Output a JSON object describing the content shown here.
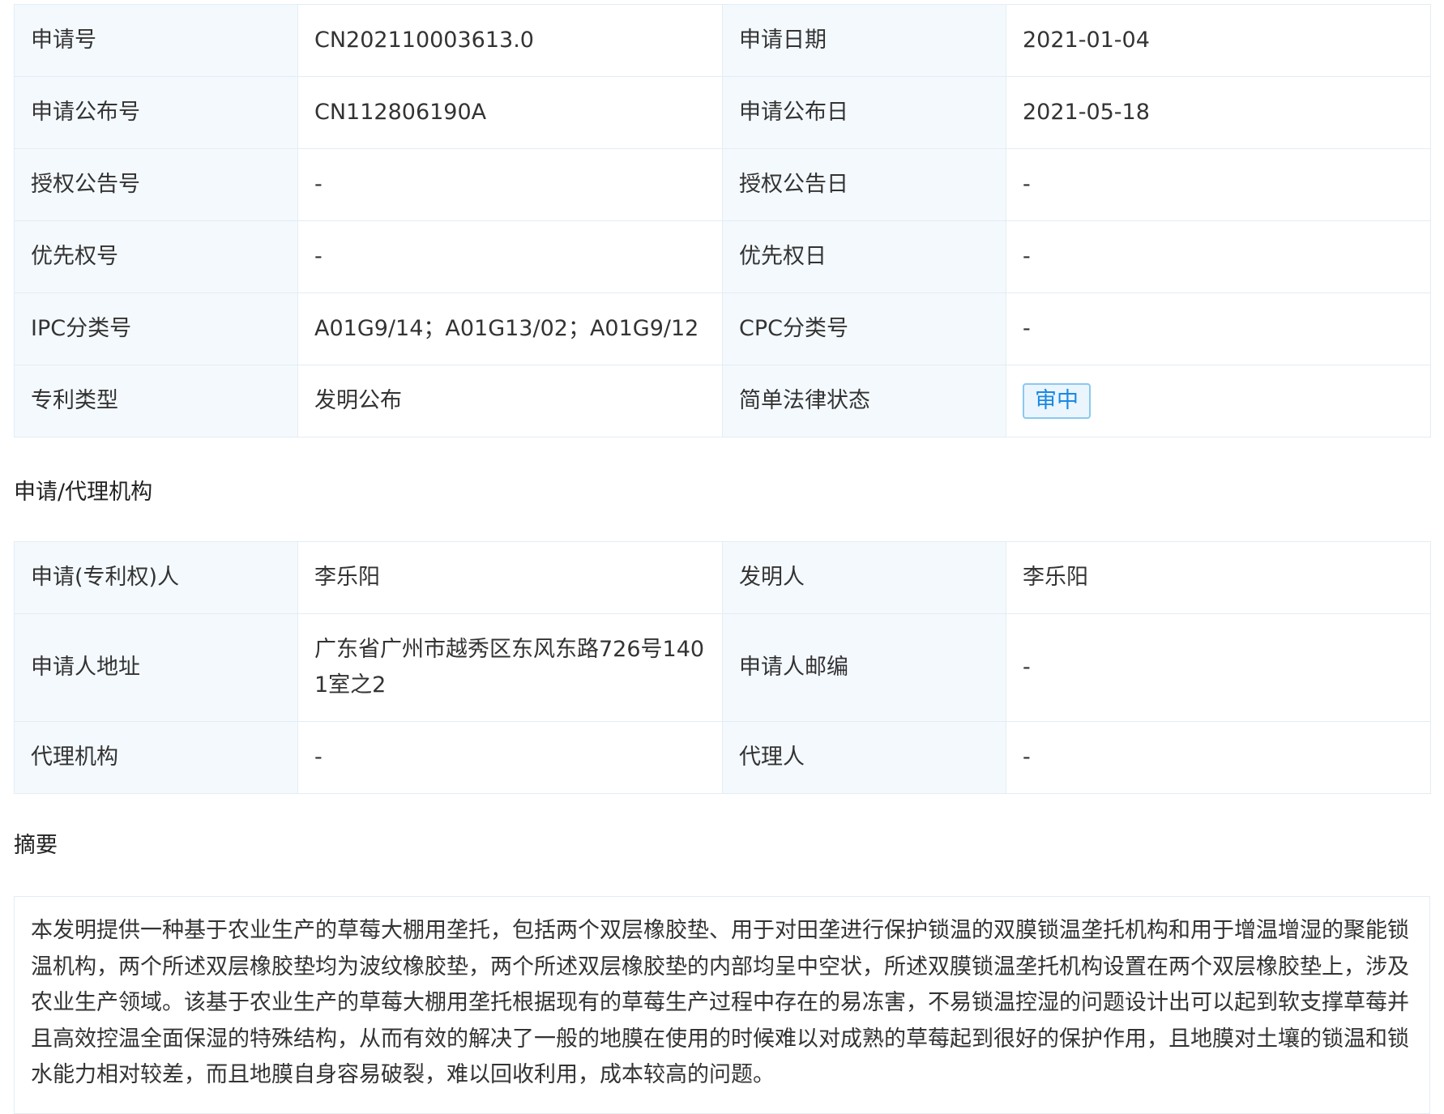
{
  "table1": {
    "rows": [
      {
        "l1": "申请号",
        "v1": "CN202110003613.0",
        "l2": "申请日期",
        "v2": "2021-01-04"
      },
      {
        "l1": "申请公布号",
        "v1": "CN112806190A",
        "l2": "申请公布日",
        "v2": "2021-05-18"
      },
      {
        "l1": "授权公告号",
        "v1": "-",
        "l2": "授权公告日",
        "v2": "-"
      },
      {
        "l1": "优先权号",
        "v1": "-",
        "l2": "优先权日",
        "v2": "-"
      },
      {
        "l1": "IPC分类号",
        "v1": "A01G9/14；A01G13/02；A01G9/12",
        "l2": "CPC分类号",
        "v2": "-"
      },
      {
        "l1": "专利类型",
        "v1": "发明公布",
        "l2": "简单法律状态",
        "v2": "审中"
      }
    ]
  },
  "section_agent": {
    "title": "申请/代理机构"
  },
  "table2": {
    "rows": [
      {
        "l1": "申请(专利权)人",
        "v1": "李乐阳",
        "l2": "发明人",
        "v2": "李乐阳"
      },
      {
        "l1": "申请人地址",
        "v1": "广东省广州市越秀区东风东路726号1401室之2",
        "l2": "申请人邮编",
        "v2": "-"
      },
      {
        "l1": "代理机构",
        "v1": "-",
        "l2": "代理人",
        "v2": "-"
      }
    ]
  },
  "section_abstract": {
    "title": "摘要",
    "text": "本发明提供一种基于农业生产的草莓大棚用垄托，包括两个双层橡胶垫、用于对田垄进行保护锁温的双膜锁温垄托机构和用于增温增湿的聚能锁温机构，两个所述双层橡胶垫均为波纹橡胶垫，两个所述双层橡胶垫的内部均呈中空状，所述双膜锁温垄托机构设置在两个双层橡胶垫上，涉及农业生产领域。该基于农业生产的草莓大棚用垄托根据现有的草莓生产过程中存在的易冻害，不易锁温控湿的问题设计出可以起到软支撑草莓并且高效控温全面保湿的特殊结构，从而有效的解决了一般的地膜在使用的时候难以对成熟的草莓起到很好的保护作用，且地膜对土壤的锁温和锁水能力相对较差，而且地膜自身容易破裂，难以回收利用，成本较高的问题。"
  },
  "colors": {
    "label_bg": "#f4f9fd",
    "border": "#e3edf5",
    "badge": "#1989e3"
  }
}
